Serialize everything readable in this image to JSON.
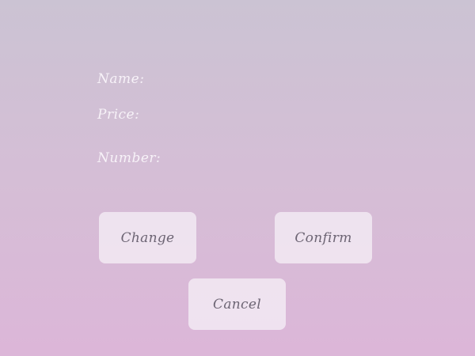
{
  "form": {
    "name_label": "Name:",
    "price_label": "Price:",
    "number_label": "Number:"
  },
  "buttons": {
    "change": "Change",
    "confirm": "Confirm",
    "cancel": "Cancel"
  },
  "colors": {
    "background_top": "#cbc3d3",
    "background_bottom": "#dcb6d8",
    "label_text": "#f7f2f8",
    "button_bg": "#f1e8f2",
    "button_text": "#6d6574"
  }
}
